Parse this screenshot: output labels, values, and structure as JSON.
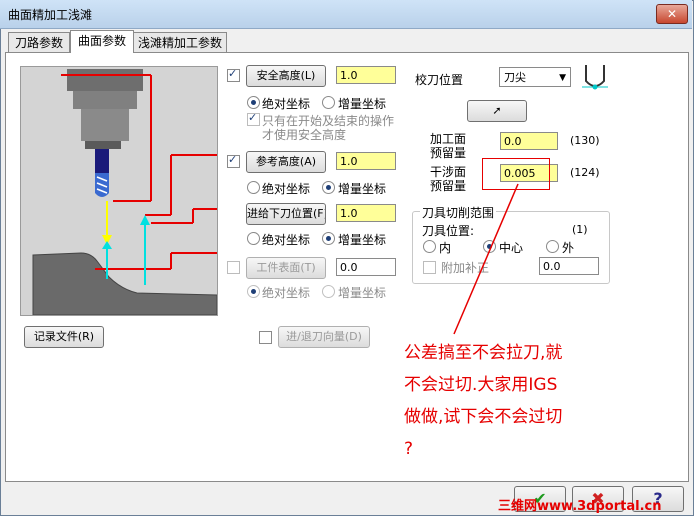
{
  "window": {
    "title": "曲面精加工浅滩"
  },
  "tabs": [
    {
      "label": "刀路参数"
    },
    {
      "label": "曲面参数"
    },
    {
      "label": "浅滩精加工参数"
    }
  ],
  "safety": {
    "button": "安全高度(L)",
    "value": "1.0",
    "checked": true
  },
  "safety_coords": {
    "abs": "绝对坐标",
    "inc": "增量坐标"
  },
  "safety_only": {
    "line1": "只有在开始及结束的操作",
    "line2": "才使用安全高度"
  },
  "reference": {
    "button": "参考高度(A)",
    "value": "1.0",
    "checked": true
  },
  "reference_coords": {
    "abs": "绝对坐标",
    "inc": "增量坐标"
  },
  "feed": {
    "button": "进给下刀位置(F)",
    "value": "1.0"
  },
  "feed_coords": {
    "abs": "绝对坐标",
    "inc": "增量坐标"
  },
  "stock": {
    "button": "工件表面(T)",
    "value": "0.0",
    "checked": false
  },
  "stock_coords": {
    "abs": "绝对坐标",
    "inc": "增量坐标"
  },
  "record_file": {
    "button": "记录文件(R)"
  },
  "entry_exit": {
    "button": "进/退刀向量(D)",
    "checked": false
  },
  "tool_pos": {
    "label": "校刀位置",
    "selected": "刀尖"
  },
  "drive_stock": {
    "label1": "加工面",
    "label2": "预留量",
    "value": "0.0",
    "count": "(130)"
  },
  "check_stock": {
    "label1": "干涉面",
    "label2": "预留量",
    "value": "0.005",
    "count": "(124)"
  },
  "cut_range": {
    "title": "刀具切削范围",
    "position_label": "刀具位置:",
    "position_count": "(1)",
    "inside": "内",
    "center": "中心",
    "outside": "外",
    "extra_label": "附加补正",
    "extra_value": "0.0"
  },
  "annotation": {
    "line1": "公差搞至不会拉刀,就",
    "line2": "不会过切.大家用IGS",
    "line3": "做做,试下会不会过切",
    "line4": "?"
  },
  "watermark": "三维网www.3dportal.cn",
  "colors": {
    "highlight_red": "#e60000",
    "input_yellow": "#ffff99"
  }
}
